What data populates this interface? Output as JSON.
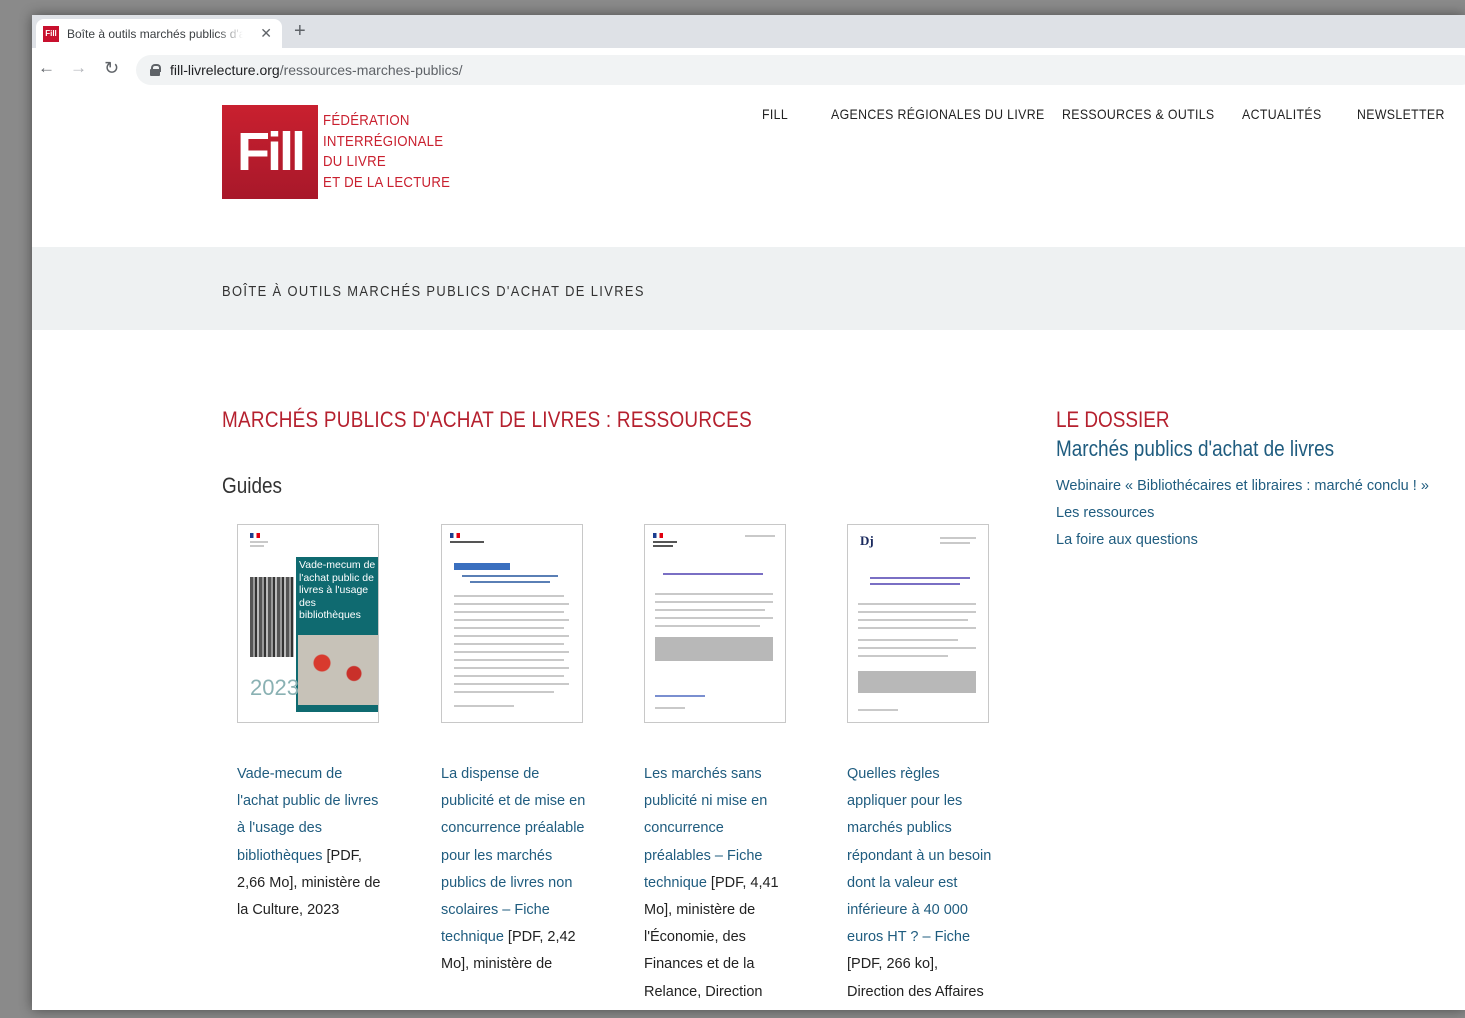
{
  "browser": {
    "tab_title": "Boîte à outils marchés publics d'achat de livres",
    "favicon_text": "Fill",
    "url_domain": "fill-livrelecture.org",
    "url_path": "/ressources-marches-publics/"
  },
  "logo": {
    "mark": "Fill",
    "lines": [
      "FÉDÉRATION",
      "INTERRÉGIONALE",
      "DU LIVRE",
      "ET DE LA LECTURE"
    ]
  },
  "nav": [
    "FILL",
    "AGENCES RÉGIONALES DU LIVRE",
    "RESSOURCES & OUTILS",
    "ACTUALITÉS",
    "NEWSLETTER"
  ],
  "band_title": "BOÎTE À OUTILS MARCHÉS PUBLICS D'ACHAT DE LIVRES",
  "section_title": "MARCHÉS PUBLICS D'ACHAT DE LIVRES : RESSOURCES",
  "subhead": "Guides",
  "guides": [
    {
      "link": "Vade-mecum de l'achat public de livres à l'usage des bibliothèques",
      "rest": " [PDF, 2,66 Mo], ministère de la Culture, 2023",
      "cover_text": "Vade-mecum de l'achat public de livres à l'usage des bibliothèques",
      "cover_year": "2023"
    },
    {
      "link": "La dispense de publicité et de mise en concurrence préalable pour les marchés publics de livres non scolaires – Fiche technique",
      "rest": " [PDF, 2,42 Mo], ministère de"
    },
    {
      "link": "Les marchés sans publicité ni mise en concurrence préalables –  Fiche technique",
      "rest": " [PDF, 4,41 Mo], ministère de l'Économie, des Finances et de la Relance, Direction"
    },
    {
      "link": "Quelles règles appliquer pour les marchés publics répondant à un besoin dont la valeur est inférieure à 40 000 euros HT ? – Fiche",
      "rest": " [PDF, 266 ko], Direction des Affaires"
    }
  ],
  "aside": {
    "kicker": "LE DOSSIER",
    "title": "Marchés publics d'achat de livres",
    "links": [
      "Webinaire « Bibliothécaires et libraires : marché conclu ! »",
      "Les ressources",
      "La foire aux questions"
    ]
  },
  "colors": {
    "brand_red": "#c9202f",
    "link_blue": "#1f5c7f",
    "band_gray": "#eef1f2"
  }
}
